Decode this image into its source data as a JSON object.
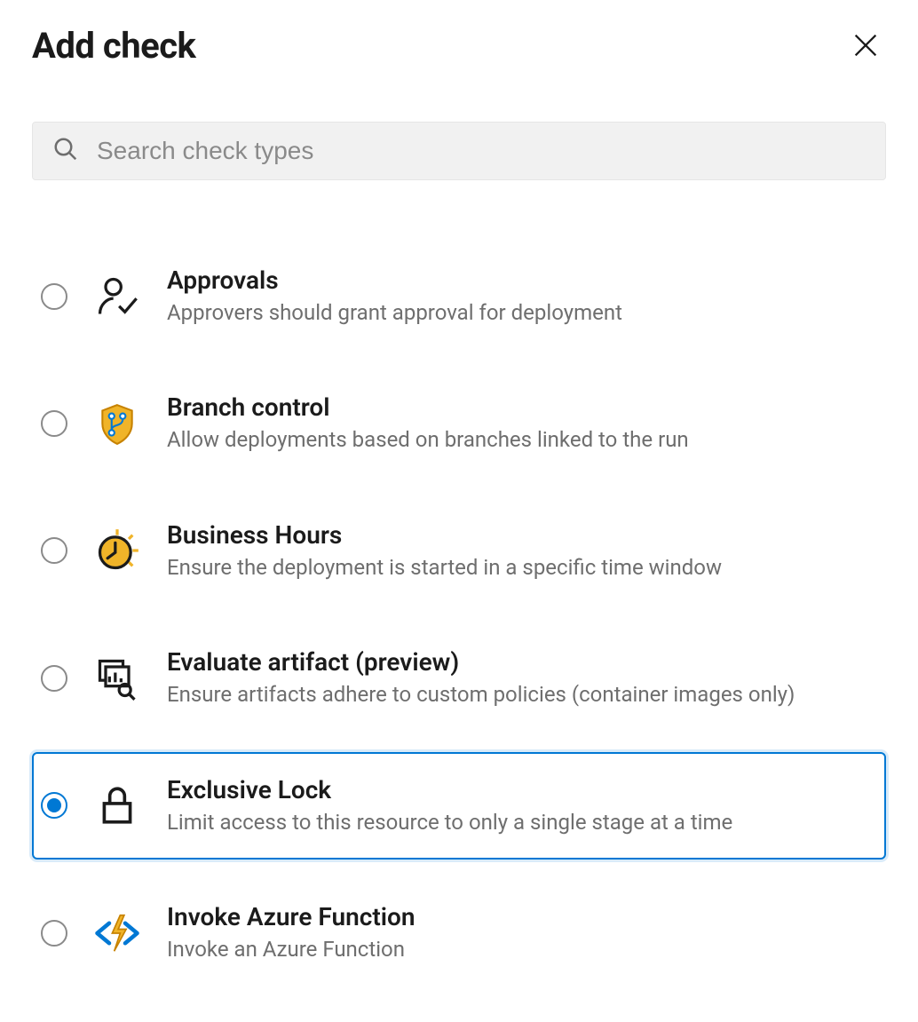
{
  "header": {
    "title": "Add check"
  },
  "search": {
    "placeholder": "Search check types",
    "value": ""
  },
  "selected_index": 4,
  "items": [
    {
      "icon": "approvals-icon",
      "title": "Approvals",
      "description": "Approvers should grant approval for deployment"
    },
    {
      "icon": "branch-control-icon",
      "title": "Branch control",
      "description": "Allow deployments based on branches linked to the run"
    },
    {
      "icon": "business-hours-icon",
      "title": "Business Hours",
      "description": "Ensure the deployment is started in a specific time window"
    },
    {
      "icon": "evaluate-artifact-icon",
      "title": "Evaluate artifact (preview)",
      "description": "Ensure artifacts adhere to custom policies (container images only)"
    },
    {
      "icon": "exclusive-lock-icon",
      "title": "Exclusive Lock",
      "description": "Limit access to this resource to only a single stage at a time"
    },
    {
      "icon": "azure-function-icon",
      "title": "Invoke Azure Function",
      "description": "Invoke an Azure Function"
    }
  ]
}
